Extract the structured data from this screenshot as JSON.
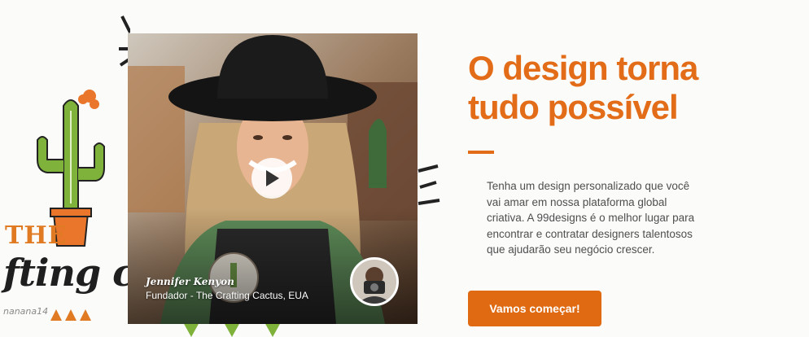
{
  "hero": {
    "heading_line1": "O design torna",
    "heading_line2": "tudo possível",
    "description": "Tenha um design personalizado que você vai amar em nossa plataforma global criativa. A 99designs é o melhor lugar para encontrar e contratar designers talentosos que ajudarão seu negócio crescer.",
    "cta_label": "Vamos começar!"
  },
  "testimonial": {
    "name": "Jennifer Kenyon",
    "role": "Fundador - The Crafting Cactus, EUA"
  },
  "artwork": {
    "brand_top": "THE",
    "brand_bottom": "fting cac",
    "credit": "nanana14"
  },
  "colors": {
    "accent": "#e36c18",
    "button": "#df6a12",
    "text": "#4f4f4f",
    "background": "#fbfbfa"
  }
}
